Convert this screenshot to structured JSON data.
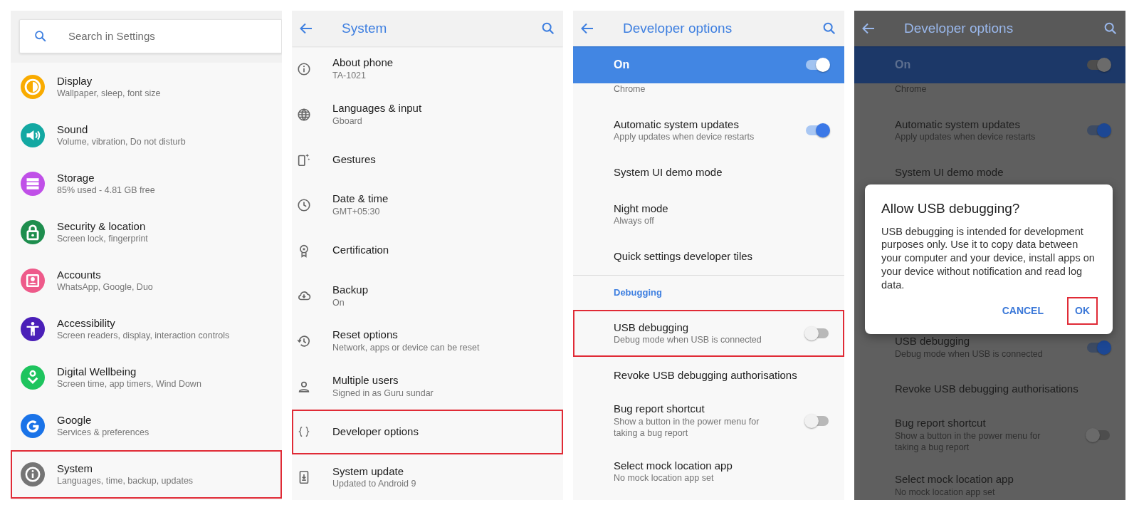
{
  "panels": [
    {
      "kind": "home",
      "search": {
        "placeholder": "Search in Settings"
      },
      "items": [
        {
          "title": "Display",
          "subtitle": "Wallpaper, sleep, font size",
          "color": "#f9ab00",
          "highlighted": false
        },
        {
          "title": "Sound",
          "subtitle": "Volume, vibration, Do not disturb",
          "color": "#13a8a2",
          "highlighted": false
        },
        {
          "title": "Storage",
          "subtitle": "85% used - 4.81 GB free",
          "color": "#c050e8",
          "highlighted": false
        },
        {
          "title": "Security & location",
          "subtitle": "Screen lock, fingerprint",
          "color": "#1e8e4e",
          "highlighted": false
        },
        {
          "title": "Accounts",
          "subtitle": "WhatsApp, Google, Duo",
          "color": "#ee5a8a",
          "highlighted": false
        },
        {
          "title": "Accessibility",
          "subtitle": "Screen readers, display, interaction controls",
          "color": "#4a1fb8",
          "highlighted": false
        },
        {
          "title": "Digital Wellbeing",
          "subtitle": "Screen time, app timers, Wind Down",
          "color": "#1ec45e",
          "highlighted": false
        },
        {
          "title": "Google",
          "subtitle": "Services & preferences",
          "color": "#1a73e8",
          "highlighted": false
        },
        {
          "title": "System",
          "subtitle": "Languages, time, backup, updates",
          "color": "#757575",
          "highlighted": true
        }
      ]
    },
    {
      "kind": "list",
      "title": "System",
      "dimmed": false,
      "items": [
        {
          "kind": "row",
          "title": "About phone",
          "subtitle": "TA-1021",
          "highlighted": false
        },
        {
          "kind": "row",
          "title": "Languages & input",
          "subtitle": "Gboard",
          "highlighted": false
        },
        {
          "kind": "row",
          "title": "Gestures",
          "highlighted": false
        },
        {
          "kind": "row",
          "title": "Date & time",
          "subtitle": "GMT+05:30",
          "highlighted": false
        },
        {
          "kind": "row",
          "title": "Certification",
          "highlighted": false
        },
        {
          "kind": "row",
          "title": "Backup",
          "subtitle": "On",
          "highlighted": false
        },
        {
          "kind": "row",
          "title": "Reset options",
          "subtitle": "Network, apps or device can be reset",
          "highlighted": false
        },
        {
          "kind": "row",
          "title": "Multiple users",
          "subtitle": "Signed in as Guru sundar",
          "highlighted": false
        },
        {
          "kind": "row",
          "title": "Developer options",
          "highlighted": true
        },
        {
          "kind": "row",
          "title": "System update",
          "subtitle": "Updated to Android 9",
          "highlighted": false
        }
      ]
    },
    {
      "kind": "list",
      "title": "Developer options",
      "dimmed": false,
      "master": {
        "label": "On",
        "on": true
      },
      "items": [
        {
          "kind": "row",
          "subtitle": "Chrome",
          "highlighted": false
        },
        {
          "kind": "switch",
          "title": "Automatic system updates",
          "subtitle": "Apply updates when device restarts",
          "on": true,
          "highlighted": false
        },
        {
          "kind": "row",
          "title": "System UI demo mode",
          "highlighted": false
        },
        {
          "kind": "row",
          "title": "Night mode",
          "subtitle": "Always off",
          "highlighted": false
        },
        {
          "kind": "row",
          "title": "Quick settings developer tiles",
          "highlighted": false
        },
        {
          "kind": "divider"
        },
        {
          "kind": "section",
          "title": "Debugging"
        },
        {
          "kind": "switch",
          "title": "USB debugging",
          "subtitle": "Debug mode when USB is connected",
          "on": false,
          "highlighted": true
        },
        {
          "kind": "row",
          "title": "Revoke USB debugging authorisations",
          "highlighted": false
        },
        {
          "kind": "switch",
          "title": "Bug report shortcut",
          "subtitle": "Show a button in the power menu for taking a bug report",
          "on": false,
          "highlighted": false
        },
        {
          "kind": "row",
          "title": "Select mock location app",
          "subtitle": "No mock location app set",
          "highlighted": false
        }
      ]
    },
    {
      "kind": "list",
      "title": "Developer options",
      "dimmed": true,
      "master": {
        "label": "On",
        "on": true
      },
      "items": [
        {
          "kind": "row",
          "subtitle": "Chrome",
          "highlighted": false
        },
        {
          "kind": "switch",
          "title": "Automatic system updates",
          "subtitle": "Apply updates when device restarts",
          "on": true,
          "highlighted": false
        },
        {
          "kind": "row",
          "title": "System UI demo mode",
          "highlighted": false
        },
        {
          "kind": "dialog",
          "title": "Allow USB debugging?",
          "message": "USB debugging is intended for development purposes only. Use it to copy data between your computer and your device, install apps on your device without notification and read log data.",
          "buttons": [
            {
              "label": "CANCEL",
              "highlighted": false
            },
            {
              "label": "OK",
              "highlighted": true
            }
          ]
        },
        {
          "kind": "switch",
          "title": "USB debugging",
          "subtitle": "Debug mode when USB is connected",
          "on": true,
          "highlighted": false
        },
        {
          "kind": "row",
          "title": "Revoke USB debugging authorisations",
          "highlighted": false
        },
        {
          "kind": "switch",
          "title": "Bug report shortcut",
          "subtitle": "Show a button in the power menu for taking a bug report",
          "on": false,
          "highlighted": false
        },
        {
          "kind": "row",
          "title": "Select mock location app",
          "subtitle": "No mock location app set",
          "highlighted": false
        }
      ]
    }
  ]
}
